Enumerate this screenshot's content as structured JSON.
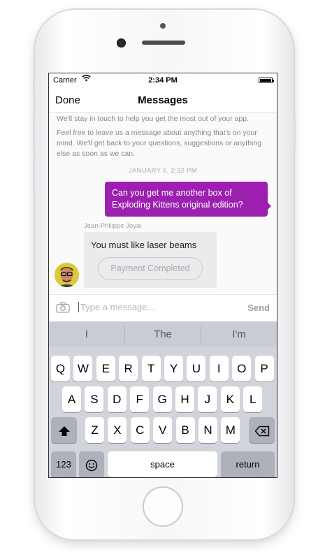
{
  "status_bar": {
    "carrier": "Carrier",
    "wifi_icon": "wifi-icon",
    "time": "2:34 PM",
    "battery_icon": "battery-icon"
  },
  "nav": {
    "done_label": "Done",
    "title": "Messages"
  },
  "conversation": {
    "intro_line1": "We'll stay in touch to help you get the most out of your app.",
    "intro_line2": "Feel free to leave us a message about anything that's on your mind. We'll get back to your questions, suggestions or anything else as soon as we can.",
    "timestamp": "JANUARY 6, 2:32 PM",
    "outgoing_message": "Can you get me another box of Exploding Kittens original edition?",
    "sender_name": "Jean-Philippe Joyal",
    "incoming_message": "You must like laser beams",
    "payment_button": "Payment Completed"
  },
  "composer": {
    "camera_icon": "camera-icon",
    "placeholder": "Type a message...",
    "send_label": "Send"
  },
  "keyboard": {
    "suggestions": [
      "I",
      "The",
      "I'm"
    ],
    "row1": [
      "Q",
      "W",
      "E",
      "R",
      "T",
      "Y",
      "U",
      "I",
      "O",
      "P"
    ],
    "row2": [
      "A",
      "S",
      "D",
      "F",
      "G",
      "H",
      "J",
      "K",
      "L"
    ],
    "row3": [
      "Z",
      "X",
      "C",
      "V",
      "B",
      "N",
      "M"
    ],
    "shift_icon": "shift-icon",
    "backspace_icon": "backspace-icon",
    "numbers_label": "123",
    "emoji_icon": "emoji-icon",
    "space_label": "space",
    "return_label": "return"
  },
  "colors": {
    "outgoing_bubble": "#9c1fb0",
    "incoming_bubble": "#ebebed",
    "keyboard_bg": "#d1d4da"
  }
}
